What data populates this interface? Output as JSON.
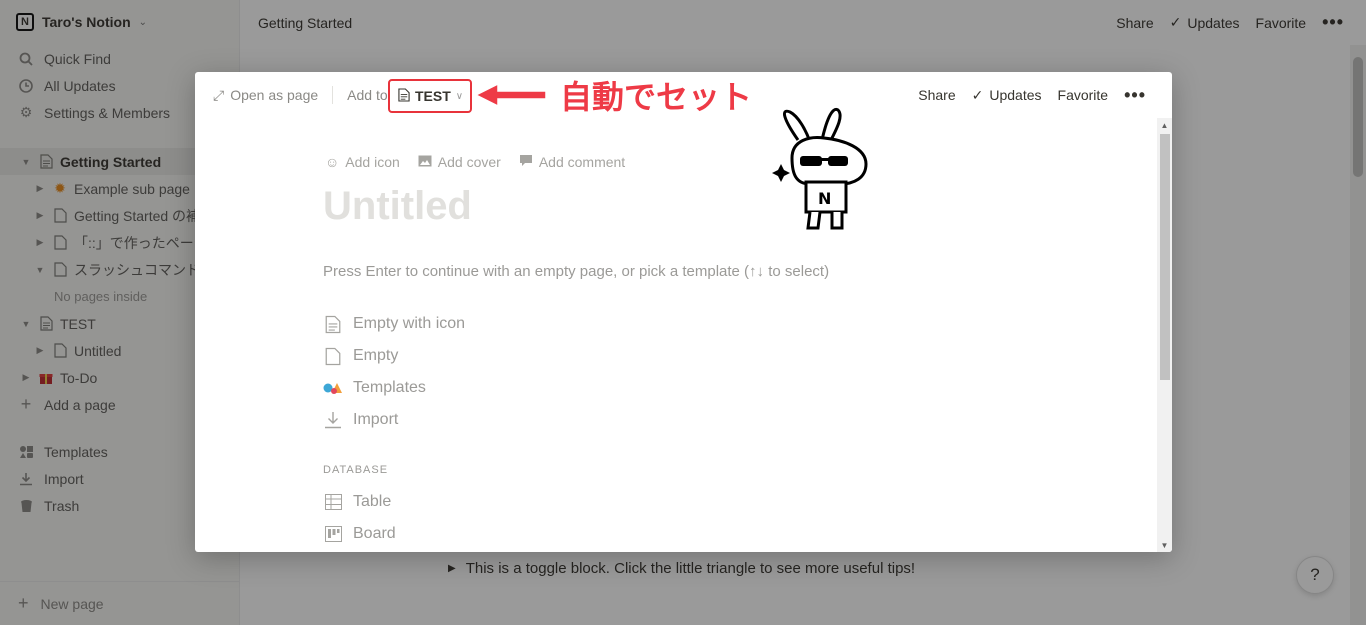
{
  "workspace": {
    "name": "Taro's Notion",
    "chevron": "⌄"
  },
  "sidebar": {
    "top_items": [
      {
        "icon": "search-icon",
        "label": "Quick Find"
      },
      {
        "icon": "clock-icon",
        "label": "All Updates"
      },
      {
        "icon": "gear-icon",
        "label": "Settings & Members"
      }
    ],
    "pages": [
      {
        "label": "Getting Started",
        "expanded": true,
        "active": true,
        "level": 0
      },
      {
        "label": "Example sub page",
        "level": 1,
        "icon": "star-icon"
      },
      {
        "label": "Getting Started の補足",
        "level": 1
      },
      {
        "label": "「::」で作ったページ",
        "level": 1
      },
      {
        "label": "スラッシュコマンド",
        "level": 1,
        "expanded": true
      },
      {
        "label": "No pages inside",
        "level": 2,
        "muted": true
      },
      {
        "label": "TEST",
        "level": 0,
        "expanded": true
      },
      {
        "label": "Untitled",
        "level": 1
      },
      {
        "label": "To-Do",
        "level": 0,
        "icon": "gift-icon"
      }
    ],
    "add_page": "Add a page",
    "bottom_items": [
      {
        "icon": "templates-icon",
        "label": "Templates"
      },
      {
        "icon": "import-icon",
        "label": "Import"
      },
      {
        "icon": "trash-icon",
        "label": "Trash"
      }
    ],
    "new_page": "New page"
  },
  "topbar": {
    "breadcrumb": "Getting Started",
    "share": "Share",
    "updates": "Updates",
    "favorite": "Favorite"
  },
  "background_page": {
    "toggle_text": "This is a toggle block. Click the little triangle to see more useful tips!"
  },
  "help_button": "?",
  "modal": {
    "open_as_page": "Open as page",
    "add_to": "Add to",
    "target_page": "TEST",
    "share": "Share",
    "updates": "Updates",
    "favorite": "Favorite",
    "add_icon": "Add icon",
    "add_cover": "Add cover",
    "add_comment": "Add comment",
    "title_placeholder": "Untitled",
    "hint": "Press Enter to continue with an empty page, or pick a template (↑↓ to select)",
    "options": [
      {
        "icon": "page-text-icon",
        "label": "Empty with icon"
      },
      {
        "icon": "page-icon",
        "label": "Empty"
      },
      {
        "icon": "templates-icon",
        "label": "Templates"
      },
      {
        "icon": "import-icon",
        "label": "Import"
      }
    ],
    "database_heading": "DATABASE",
    "database_options": [
      {
        "icon": "table-icon",
        "label": "Table"
      },
      {
        "icon": "board-icon",
        "label": "Board"
      }
    ]
  },
  "annotation": {
    "callout": "自動でセット",
    "accent": "#ee3a46"
  }
}
